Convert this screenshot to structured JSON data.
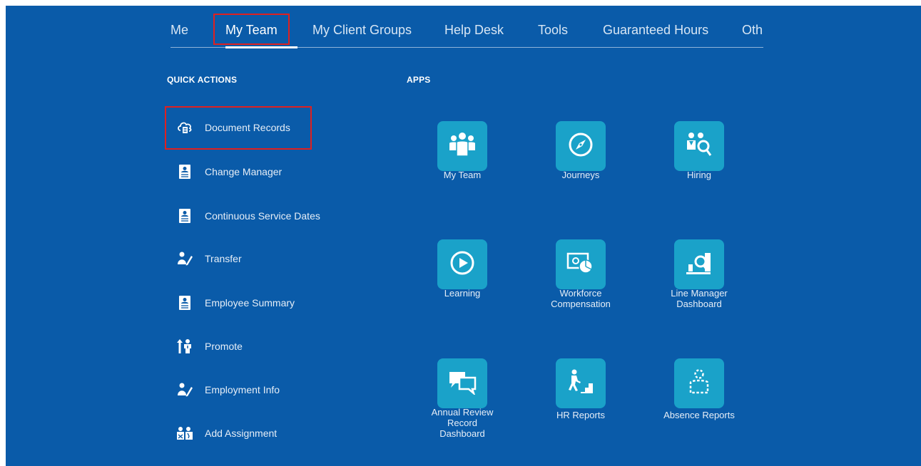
{
  "tabs": [
    {
      "label": "Me"
    },
    {
      "label": "My Team"
    },
    {
      "label": "My Client Groups"
    },
    {
      "label": "Help Desk"
    },
    {
      "label": "Tools"
    },
    {
      "label": "Guaranteed Hours"
    },
    {
      "label": "Oth"
    }
  ],
  "quick_actions": {
    "title": "QUICK ACTIONS",
    "items": [
      {
        "label": "Document Records",
        "icon": "cloud-document-icon"
      },
      {
        "label": "Change Manager",
        "icon": "id-badge-icon"
      },
      {
        "label": "Continuous Service Dates",
        "icon": "id-badge-icon"
      },
      {
        "label": "Transfer",
        "icon": "person-edit-icon"
      },
      {
        "label": "Employee Summary",
        "icon": "id-badge-icon"
      },
      {
        "label": "Promote",
        "icon": "person-up-arrow-icon"
      },
      {
        "label": "Employment Info",
        "icon": "person-edit-icon"
      },
      {
        "label": "Add Assignment",
        "icon": "people-assignment-icon"
      }
    ]
  },
  "apps": {
    "title": "APPS",
    "items": [
      {
        "label": "My Team",
        "icon": "team-icon"
      },
      {
        "label": "Journeys",
        "icon": "compass-icon"
      },
      {
        "label": "Hiring",
        "icon": "people-search-icon"
      },
      {
        "label": "Learning",
        "icon": "play-circle-icon"
      },
      {
        "label": "Workforce Compensation",
        "icon": "money-chart-icon"
      },
      {
        "label": "Line Manager Dashboard",
        "icon": "dashboard-search-icon"
      },
      {
        "label": "Annual Review Record Dashboard",
        "icon": "chat-bubbles-icon"
      },
      {
        "label": "HR Reports",
        "icon": "person-stairs-icon"
      },
      {
        "label": "Absence Reports",
        "icon": "absent-person-icon"
      }
    ]
  },
  "colors": {
    "background": "#0a5ba9",
    "tile": "#1aa2c9",
    "highlight": "#e0201f"
  }
}
